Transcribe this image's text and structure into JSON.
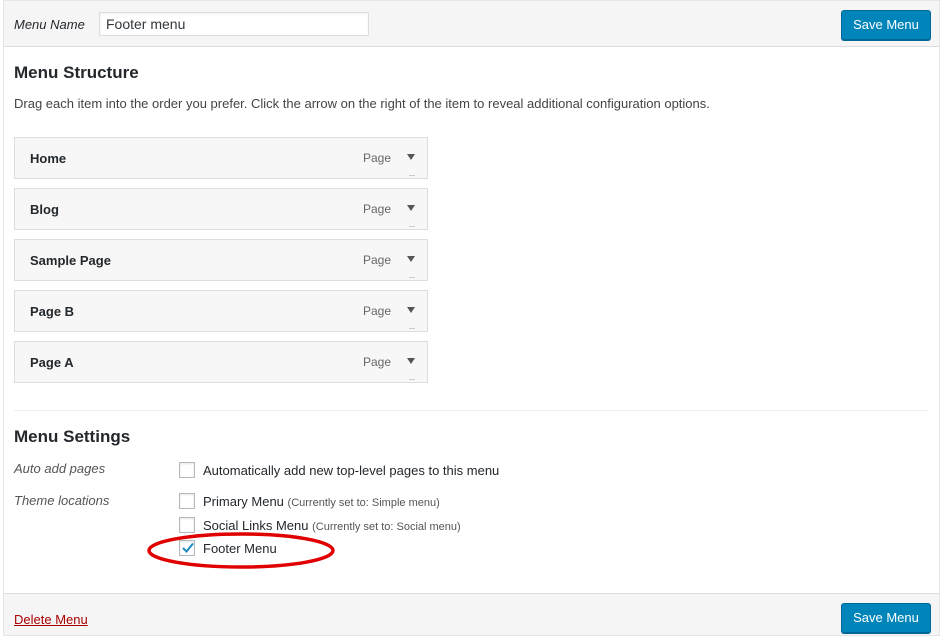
{
  "header": {
    "menu_name_label": "Menu Name",
    "menu_name_value": "Footer menu",
    "save_label": "Save Menu"
  },
  "structure": {
    "title": "Menu Structure",
    "instructions": "Drag each item into the order you prefer. Click the arrow on the right of the item to reveal additional configuration options.",
    "items": [
      {
        "title": "Home",
        "type": "Page"
      },
      {
        "title": "Blog",
        "type": "Page"
      },
      {
        "title": "Sample Page",
        "type": "Page"
      },
      {
        "title": "Page B",
        "type": "Page"
      },
      {
        "title": "Page A",
        "type": "Page"
      }
    ]
  },
  "settings": {
    "title": "Menu Settings",
    "auto_add_label": "Auto add pages",
    "auto_add_option": "Automatically add new top-level pages to this menu",
    "auto_add_checked": false,
    "theme_locations_label": "Theme locations",
    "locations": [
      {
        "name": "Primary Menu",
        "note": "(Currently set to: Simple menu)",
        "checked": false
      },
      {
        "name": "Social Links Menu",
        "note": "(Currently set to: Social menu)",
        "checked": false
      },
      {
        "name": "Footer Menu",
        "note": "",
        "checked": true
      }
    ]
  },
  "footer": {
    "delete_label": "Delete Menu",
    "save_label": "Save Menu"
  },
  "colors": {
    "primary_button": "#0085ba",
    "delete_link": "#aa0000",
    "highlight": "#e00000",
    "checkmark": "#1e8cbe"
  },
  "icons": {
    "item_arrow": "triangle-down-icon",
    "checked": "checkmark-icon"
  }
}
